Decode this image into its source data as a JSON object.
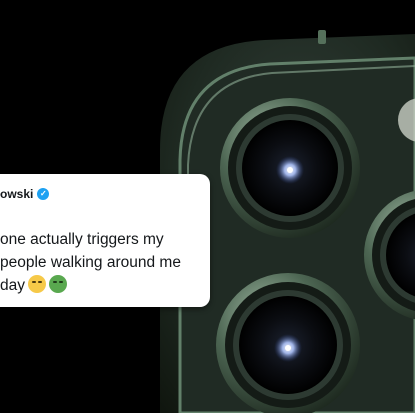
{
  "tweet": {
    "author_partial": "owski",
    "verified_icon": "verified-badge-icon",
    "lines": [
      "one actually triggers my",
      "people walking around me",
      "day"
    ],
    "emojis": [
      "relieved-face-emoji",
      "nauseated-face-emoji"
    ]
  },
  "colors": {
    "background": "#000000",
    "phone_body": "#253127",
    "lens_ring": "#6b8a6f",
    "verified": "#1da1f2"
  }
}
